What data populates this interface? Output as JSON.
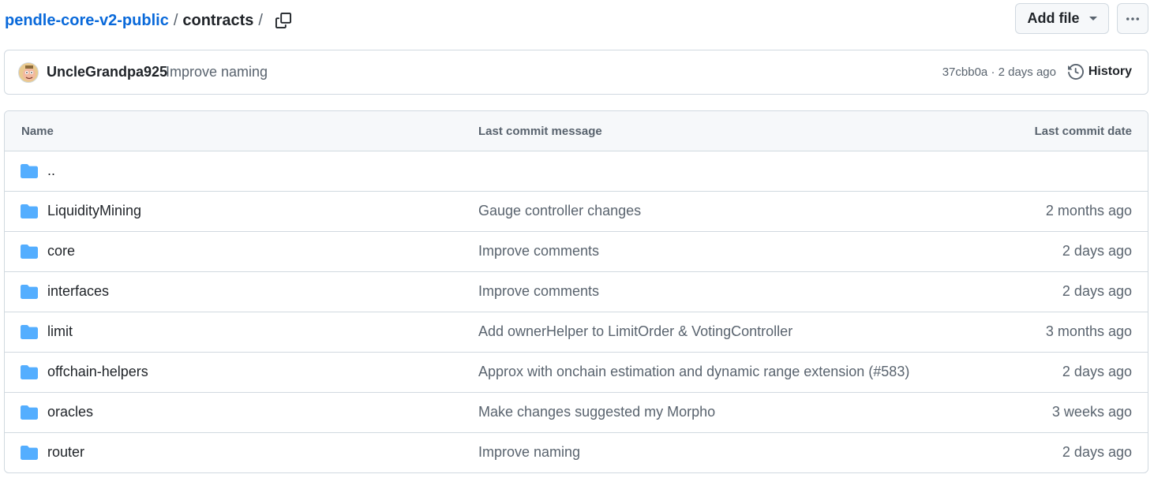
{
  "breadcrumb": {
    "repo": "pendle-core-v2-public",
    "separator": "/",
    "current": "contracts",
    "trailing_separator": "/"
  },
  "actions": {
    "add_file_label": "Add file"
  },
  "latest_commit": {
    "author": "UncleGrandpa925",
    "message": "Improve naming",
    "meta": "37cbb0a · 2 days ago",
    "history_label": "History"
  },
  "table": {
    "headers": {
      "name": "Name",
      "message": "Last commit message",
      "date": "Last commit date"
    },
    "parent_row": "..",
    "rows": [
      {
        "name": "LiquidityMining",
        "message": "Gauge controller changes",
        "date": "2 months ago"
      },
      {
        "name": "core",
        "message": "Improve comments",
        "date": "2 days ago"
      },
      {
        "name": "interfaces",
        "message": "Improve comments",
        "date": "2 days ago"
      },
      {
        "name": "limit",
        "message": "Add ownerHelper to LimitOrder & VotingController",
        "date": "3 months ago"
      },
      {
        "name": "offchain-helpers",
        "message": "Approx with onchain estimation and dynamic range extension (#583)",
        "date": "2 days ago"
      },
      {
        "name": "oracles",
        "message": "Make changes suggested my Morpho",
        "date": "3 weeks ago"
      },
      {
        "name": "router",
        "message": "Improve naming",
        "date": "2 days ago"
      }
    ]
  },
  "colors": {
    "link": "#0969da",
    "folder": "#54aeff",
    "muted": "#59636e",
    "border": "#d1d9e0"
  },
  "icons": {
    "copy": "copy-icon",
    "caret": "triangle-down-icon",
    "more": "kebab-horizontal-icon",
    "history": "history-icon",
    "folder": "folder-icon"
  }
}
